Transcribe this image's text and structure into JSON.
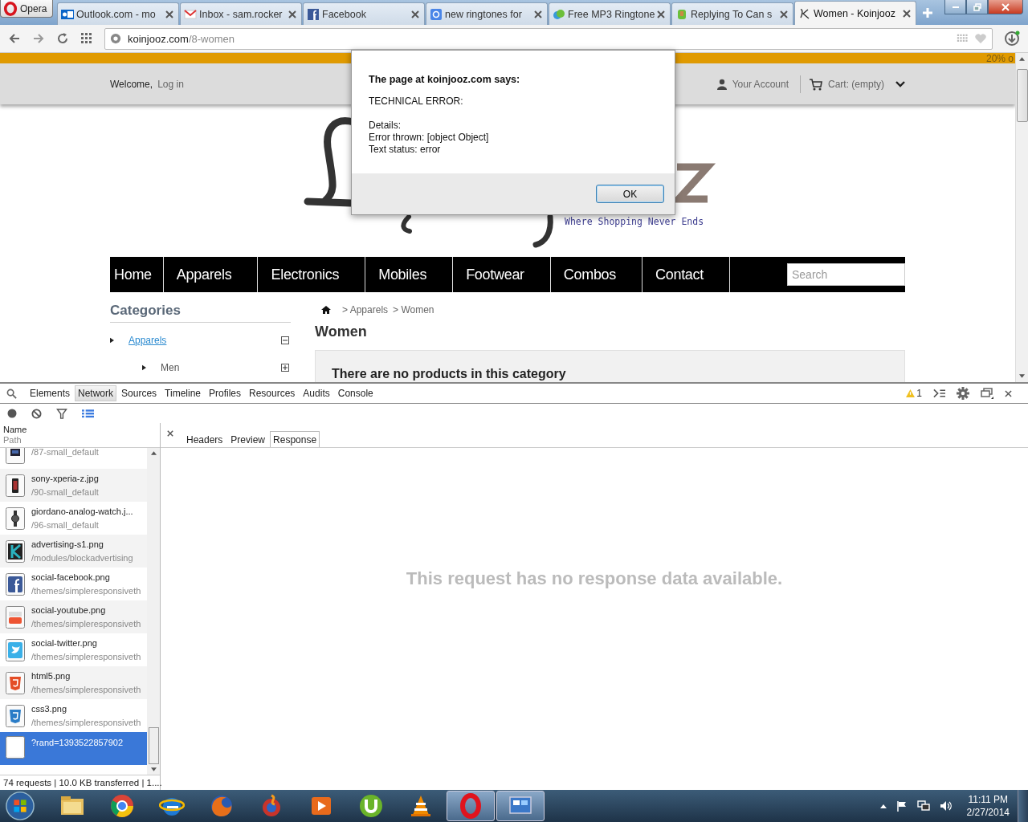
{
  "browser": {
    "menu_label": "Opera",
    "tabs": [
      {
        "title": "Outlook.com - mo",
        "kind": "outlook",
        "selected": false
      },
      {
        "title": "Inbox - sam.rocker",
        "kind": "mail",
        "selected": false
      },
      {
        "title": "Facebook",
        "kind": "facebook",
        "selected": false
      },
      {
        "title": "new ringtones for",
        "kind": "search",
        "selected": false
      },
      {
        "title": "Free MP3 Ringtone",
        "kind": "leaf",
        "selected": false
      },
      {
        "title": "Replying To Can s",
        "kind": "bug",
        "selected": false
      },
      {
        "title": "Women - Koinjooz",
        "kind": "site",
        "selected": true
      }
    ],
    "address": {
      "host": "koinjooz.com",
      "path": "/8-women"
    }
  },
  "page": {
    "promo": "20% o",
    "welcome": "Welcome,",
    "login": "Log in",
    "account": "Your Account",
    "cart": "Cart: (empty)",
    "tagline": "Where Shopping Never Ends",
    "nav": [
      "Home",
      "Apparels",
      "Electronics",
      "Mobiles",
      "Footwear",
      "Combos",
      "Contact"
    ],
    "search": {
      "placeholder": "Search"
    },
    "categories_title": "Categories",
    "categories": [
      {
        "label": "Apparels",
        "expanded": true,
        "children": [
          {
            "label": "Men",
            "expanded": false
          }
        ]
      }
    ],
    "breadcrumb": [
      "> Apparels",
      "> Women"
    ],
    "title": "Women",
    "empty_message": "There are no products in this category"
  },
  "dialog": {
    "title": "The page at koinjooz.com says:",
    "heading": "TECHNICAL ERROR:",
    "details": [
      "Details:",
      "Error thrown: [object Object]",
      "Text status: error"
    ],
    "button": "OK"
  },
  "devtools": {
    "tabs": [
      {
        "label": "Elements",
        "selected": false
      },
      {
        "label": "Network",
        "selected": true
      },
      {
        "label": "Sources",
        "selected": false
      },
      {
        "label": "Timeline",
        "selected": false
      },
      {
        "label": "Profiles",
        "selected": false
      },
      {
        "label": "Resources",
        "selected": false
      },
      {
        "label": "Audits",
        "selected": false
      },
      {
        "label": "Console",
        "selected": false
      }
    ],
    "warnings": "1",
    "columns": [
      "Name",
      "Path"
    ],
    "requests": [
      {
        "path": "/87-small_default",
        "kind": "screen",
        "selected": false
      },
      {
        "name": "sony-xperia-z.jpg",
        "path": "/90-small_default",
        "kind": "phone",
        "selected": false
      },
      {
        "name": "giordano-analog-watch.j...",
        "path": "/96-small_default",
        "kind": "watch",
        "selected": false
      },
      {
        "name": "advertising-s1.png",
        "path": "/modules/blockadvertising",
        "kind": "k",
        "selected": false
      },
      {
        "name": "social-facebook.png",
        "path": "/themes/simpleresponsiveth",
        "kind": "facebook",
        "selected": false
      },
      {
        "name": "social-youtube.png",
        "path": "/themes/simpleresponsiveth",
        "kind": "youtube",
        "selected": false
      },
      {
        "name": "social-twitter.png",
        "path": "/themes/simpleresponsiveth",
        "kind": "twitter",
        "selected": false
      },
      {
        "name": "html5.png",
        "path": "/themes/simpleresponsiveth",
        "kind": "html5",
        "selected": false
      },
      {
        "name": "css3.png",
        "path": "/themes/simpleresponsiveth",
        "kind": "css3",
        "selected": false
      },
      {
        "name": "?rand=1393522857902",
        "kind": "blank",
        "selected": true
      }
    ],
    "summary": "74 requests | 10.0 KB transferred | 1....",
    "detail_tabs": [
      {
        "label": "Headers",
        "selected": false
      },
      {
        "label": "Preview",
        "selected": false
      },
      {
        "label": "Response",
        "selected": true
      }
    ],
    "no_data": "This request has no response data available."
  },
  "taskbar": {
    "apps": [
      {
        "kind": "folder",
        "active": false
      },
      {
        "kind": "ball",
        "active": false
      },
      {
        "kind": "globe",
        "active": false
      },
      {
        "kind": "fox",
        "active": false
      },
      {
        "kind": "swirl",
        "active": false
      },
      {
        "kind": "player",
        "active": false
      },
      {
        "kind": "torrent",
        "active": false
      },
      {
        "kind": "cone",
        "active": false
      },
      {
        "kind": "ring",
        "active": true
      },
      {
        "kind": "panel",
        "active": true
      }
    ],
    "time": "11:11 PM",
    "date": "2/27/2014"
  }
}
